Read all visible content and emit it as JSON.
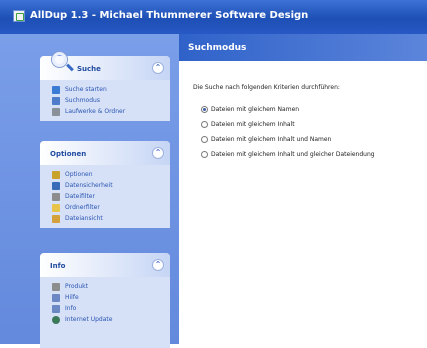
{
  "window": {
    "title": "AllDup 1.3 - Michael Thummerer Software Design"
  },
  "sidebar": {
    "groups": [
      {
        "title": "Suche",
        "items": [
          {
            "label": "Suche starten",
            "icon": "play-icon",
            "color": "#3a7bd5"
          },
          {
            "label": "Suchmodus",
            "icon": "search-mode-icon",
            "color": "#4f7cc9"
          },
          {
            "label": "Laufwerke & Ordner",
            "icon": "drive-icon",
            "color": "#8a8f9a"
          }
        ]
      },
      {
        "title": "Optionen",
        "items": [
          {
            "label": "Optionen",
            "icon": "options-icon",
            "color": "#c9a22a"
          },
          {
            "label": "Datensicherheit",
            "icon": "security-icon",
            "color": "#3a6bb8"
          },
          {
            "label": "Dateifilter",
            "icon": "filter-icon",
            "color": "#8d8d8d"
          },
          {
            "label": "Ordnerfilter",
            "icon": "folder-icon",
            "color": "#e8c54a"
          },
          {
            "label": "Dateiansicht",
            "icon": "file-view-icon",
            "color": "#d4a13a"
          }
        ]
      },
      {
        "title": "Info",
        "items": [
          {
            "label": "Produkt",
            "icon": "product-icon",
            "color": "#8d8d8d"
          },
          {
            "label": "Hilfe",
            "icon": "help-icon",
            "color": "#6b88c4"
          },
          {
            "label": "Info",
            "icon": "info-icon",
            "color": "#6b88c4"
          },
          {
            "label": "Internet Update",
            "icon": "globe-icon",
            "color": "#3a7a5a"
          }
        ]
      }
    ]
  },
  "main": {
    "header": "Suchmodus",
    "intro": "Die Suche nach folgenden Kriterien durchführen:",
    "options": [
      {
        "label": "Dateien mit gleichem Namen",
        "selected": true
      },
      {
        "label": "Dateien mit gleichem Inhalt",
        "selected": false
      },
      {
        "label": "Dateien mit gleichem Inhalt und Namen",
        "selected": false
      },
      {
        "label": "Dateien mit gleichem Inhalt und gleicher Dateiendung",
        "selected": false
      }
    ]
  }
}
